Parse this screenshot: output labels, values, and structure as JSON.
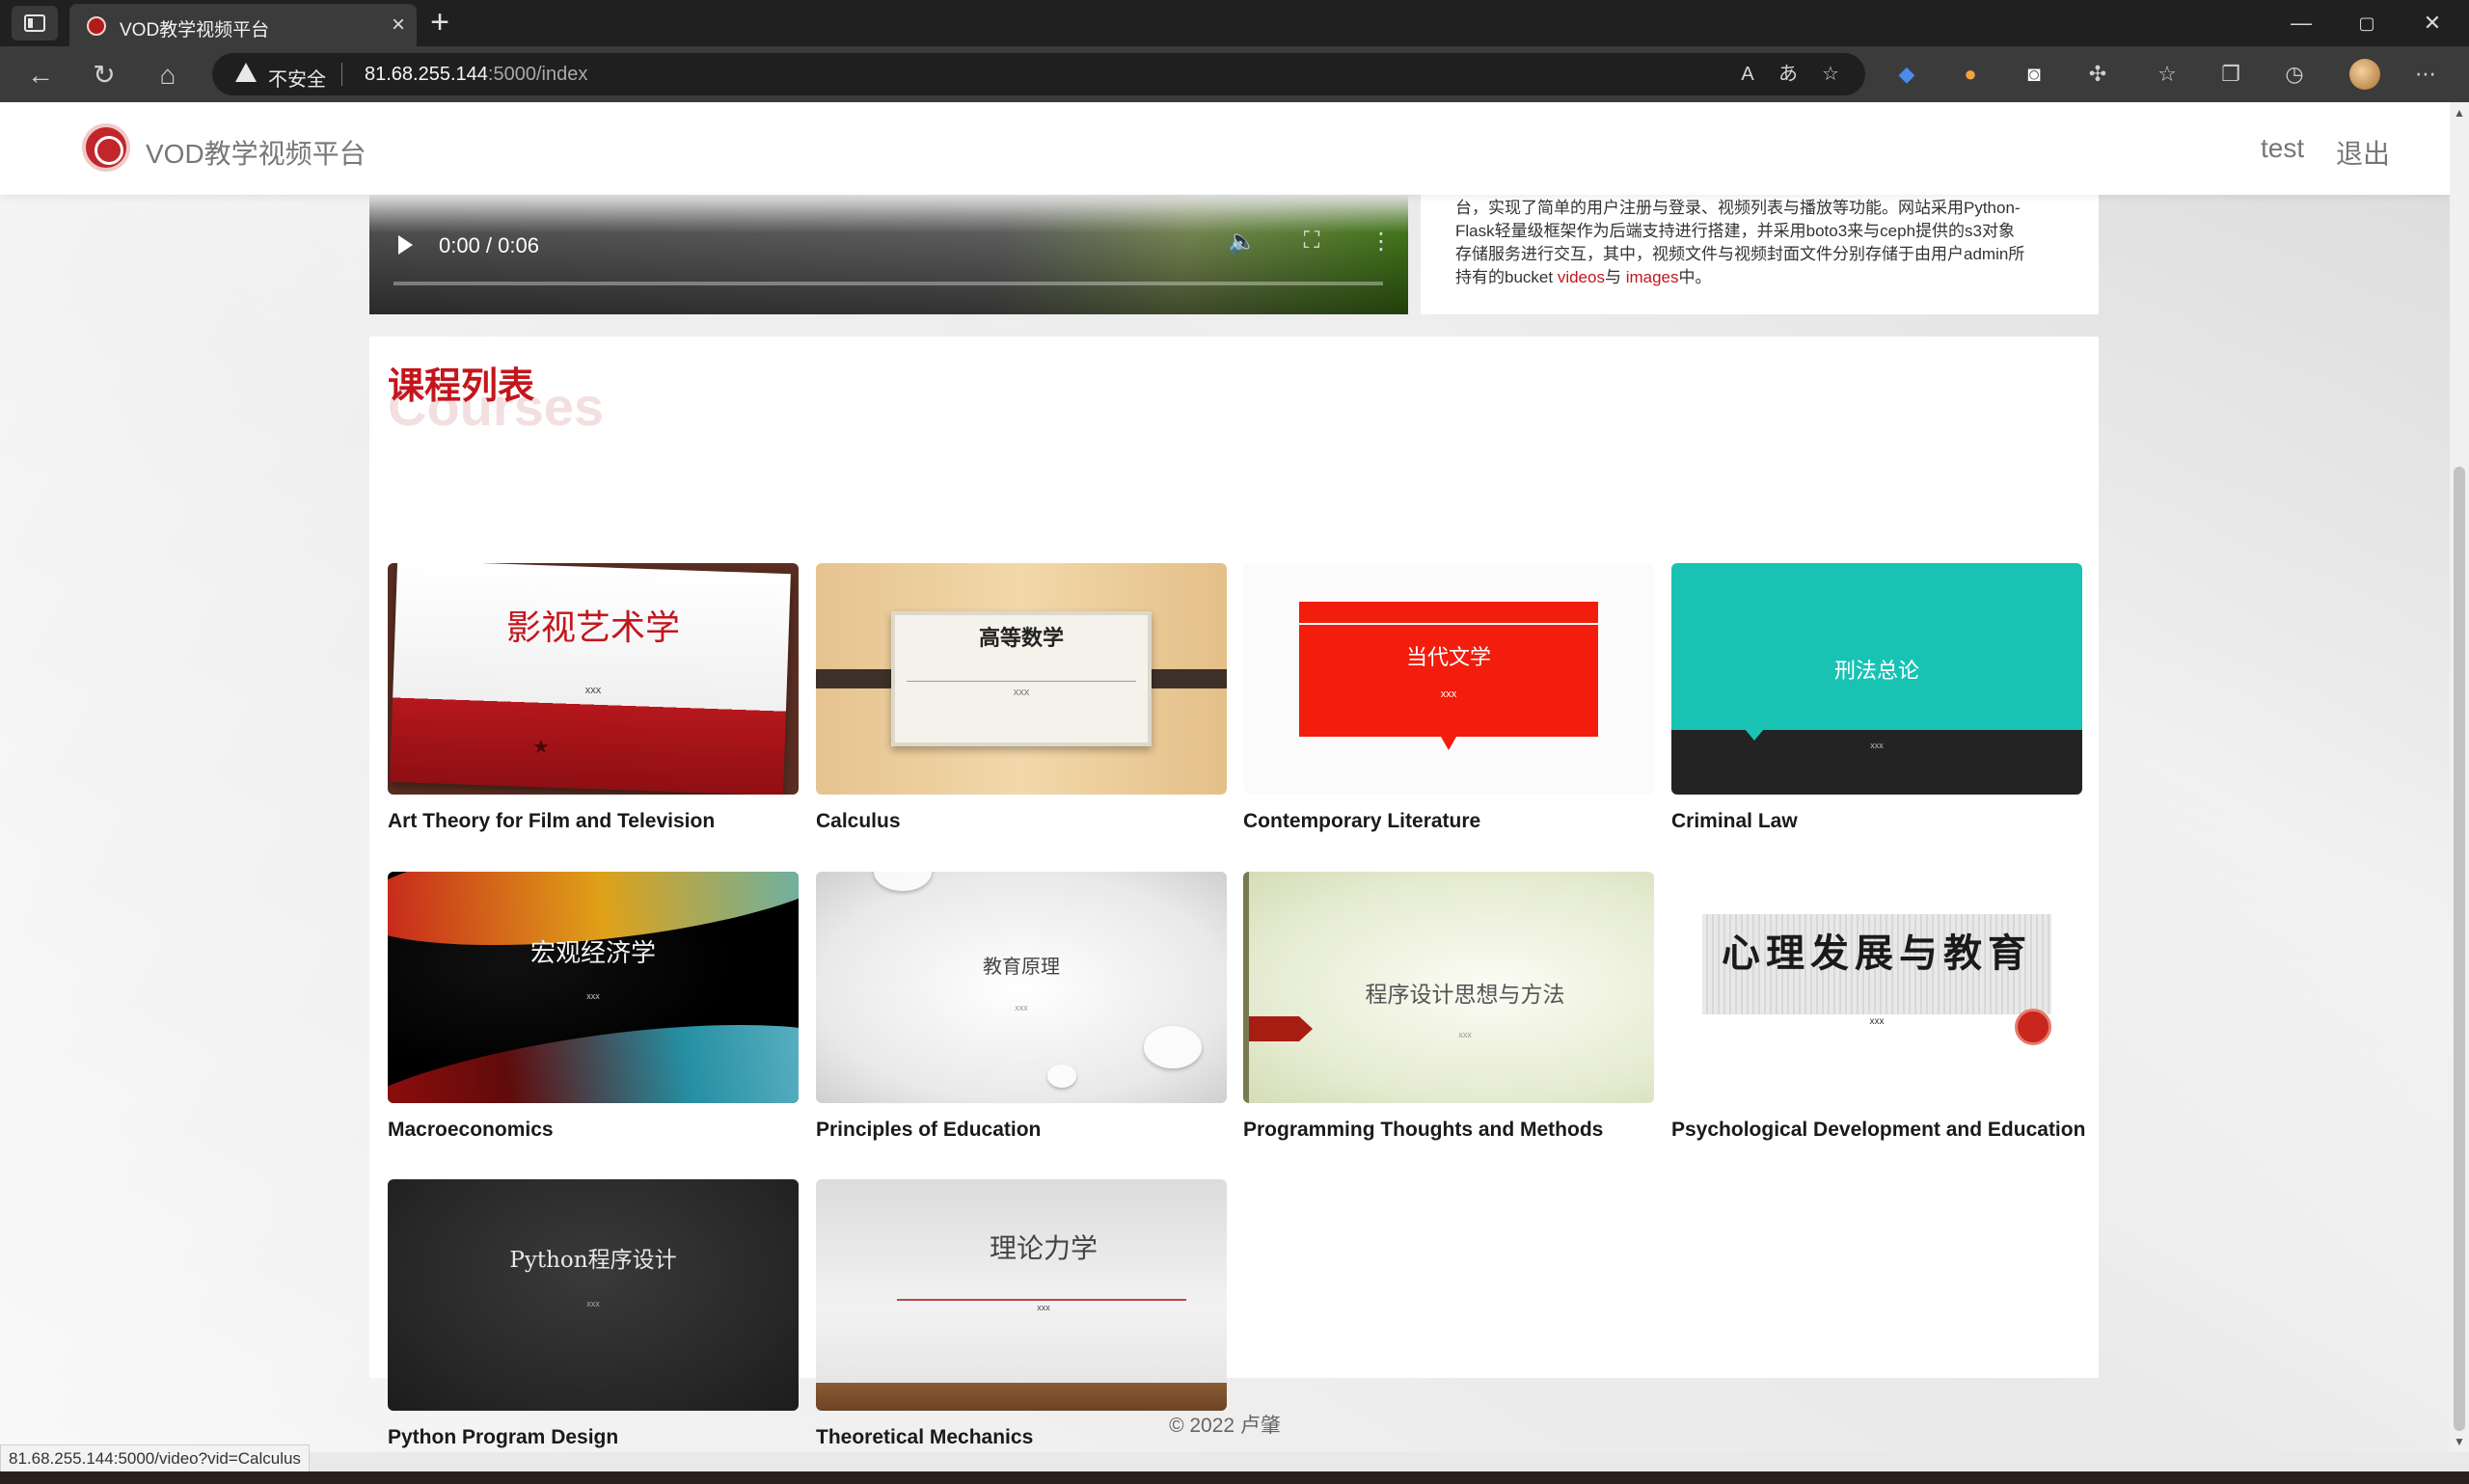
{
  "browser": {
    "tab_title": "VOD教学视频平台",
    "tab_close": "×",
    "new_tab": "+",
    "window_controls": {
      "minimize": "—",
      "maximize": "▢",
      "close": "✕"
    },
    "security_label": "不安全",
    "url_host": "81.68.255.144",
    "url_rest": ":5000/index",
    "status_url": "81.68.255.144:5000/video?vid=Calculus",
    "address_icons": [
      "read-aloud-icon",
      "translate-icon",
      "add-favorite-icon"
    ],
    "toolbar_icons": [
      "extension-blue-icon",
      "extension-colorful-icon",
      "extension-mask-icon",
      "extensions-puzzle-icon",
      "favorites-icon",
      "collections-icon",
      "history-icon",
      "more-menu-icon"
    ]
  },
  "site": {
    "title": "VOD教学视频平台",
    "user": "test",
    "logout": "退出"
  },
  "video": {
    "time": "0:00 / 0:06",
    "progress": 0
  },
  "description": {
    "line1": "台，实现了简单的用户注册与登录、视频列表与播放等功能。网站采用Python-",
    "line2": "Flask轻量级框架作为后端支持进行搭建，并采用boto3来与ceph提供的s3对象",
    "line3": "存储服务进行交互，其中，视频文件与视频封面文件分别存储于由用户admin所",
    "line4_pre": "持有的bucket ",
    "link_videos": "videos",
    "line4_mid": "与 ",
    "link_images": "images",
    "line4_post": "中。"
  },
  "courses_section": {
    "title": "课程列表",
    "title_bg": "Courses"
  },
  "courses": [
    {
      "name": "Art Theory for Film and Television",
      "cover_text": "影视艺术学",
      "cover_sub": "xxx"
    },
    {
      "name": "Calculus",
      "cover_text": "高等数学",
      "cover_sub": "xxx"
    },
    {
      "name": "Contemporary Literature",
      "cover_text": "当代文学",
      "cover_sub": "xxx"
    },
    {
      "name": "Criminal Law",
      "cover_text": "刑法总论",
      "cover_sub": "xxx"
    },
    {
      "name": "Macroeconomics",
      "cover_text": "宏观经济学",
      "cover_sub": "xxx"
    },
    {
      "name": "Principles of Education",
      "cover_text": "教育原理",
      "cover_sub": "xxx"
    },
    {
      "name": "Programming Thoughts and Methods",
      "cover_text": "程序设计思想与方法",
      "cover_sub": "xxx"
    },
    {
      "name": "Psychological Development and Education",
      "cover_text": "心理发展与教育",
      "cover_sub": "xxx"
    },
    {
      "name": "Python Program Design",
      "cover_text": "Python程序设计",
      "cover_sub": "xxx"
    },
    {
      "name": "Theoretical Mechanics",
      "cover_text": "理论力学",
      "cover_sub": "xxx"
    }
  ],
  "footer": "© 2022 卢肇"
}
